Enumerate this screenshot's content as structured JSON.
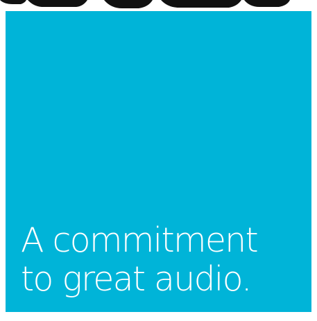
{
  "tile": {
    "background_color": "#00b4d8",
    "text_color": "#ffffff",
    "headline_line1": "A commitment",
    "headline_line2": "to great audio."
  },
  "top_strip": {
    "description": "cropped portion of a dark photo above the tile",
    "color": "#111111"
  }
}
